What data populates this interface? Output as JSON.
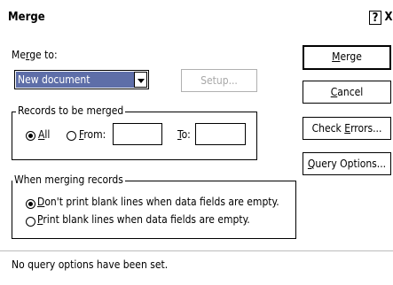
{
  "window": {
    "title": "Merge",
    "help_label": "?",
    "close_label": "X"
  },
  "merge_to": {
    "label_pre": "Me",
    "label_key": "r",
    "label_post": "ge to:",
    "selected": "New document",
    "setup_label": "Setup..."
  },
  "records": {
    "legend": "Records to be merged",
    "all_key": "A",
    "all_post": "ll",
    "from_key": "F",
    "from_post": "rom:",
    "from_value": "",
    "to_key": "T",
    "to_post": "o:",
    "to_value": "",
    "selected": "All"
  },
  "when_merging": {
    "legend": "When merging records",
    "option1_key": "D",
    "option1_post": "on't print blank lines when data fields are empty.",
    "option2_key": "P",
    "option2_post": "rint blank lines when data fields are empty.",
    "selected": "option1"
  },
  "buttons": {
    "merge_key": "M",
    "merge_post": "erge",
    "cancel_key": "C",
    "cancel_post": "ancel",
    "check_pre": "Check ",
    "check_key": "E",
    "check_post": "rrors...",
    "query_key": "Q",
    "query_post": "uery Options..."
  },
  "status": {
    "text": "No query options have been set."
  }
}
